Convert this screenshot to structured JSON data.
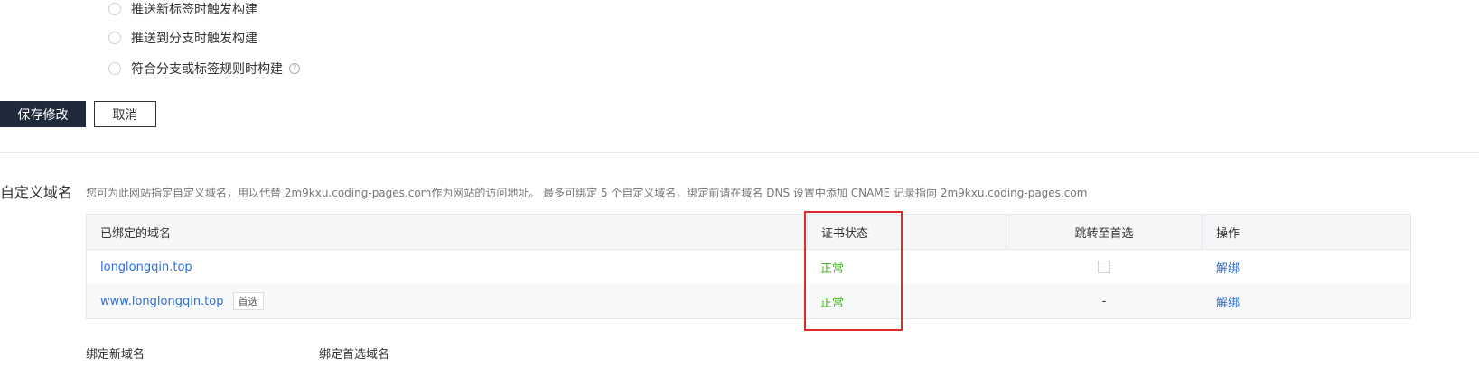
{
  "build_triggers": {
    "options": [
      {
        "label": "推送新标签时触发构建"
      },
      {
        "label": "推送到分支时触发构建"
      },
      {
        "label": "符合分支或标签规则时构建"
      }
    ],
    "help_icon": "?"
  },
  "actions": {
    "save_label": "保存修改",
    "cancel_label": "取消"
  },
  "custom_domain": {
    "title": "自定义域名",
    "description": "您可为此网站指定自定义域名，用以代替 2m9kxu.coding-pages.com作为网站的访问地址。 最多可绑定 5 个自定义域名，绑定前请在域名 DNS 设置中添加 CNAME 记录指向 2m9kxu.coding-pages.com",
    "table": {
      "headers": [
        "已绑定的域名",
        "证书状态",
        "跳转至首选",
        "操作"
      ],
      "rows": [
        {
          "domain": "longlongqin.top",
          "tag": "",
          "status": "正常",
          "redirect": "",
          "action": "解绑"
        },
        {
          "domain": "www.longlongqin.top",
          "tag": "首选",
          "status": "正常",
          "redirect": "-",
          "action": "解绑"
        }
      ]
    },
    "bind_new_label": "绑定新域名",
    "bind_preferred_label": "绑定首选域名"
  },
  "colors": {
    "primary_button": "#1f2a3c",
    "link": "#2d6fd6",
    "status_ok": "#4cb82b",
    "highlight_box": "#e02b2b"
  }
}
